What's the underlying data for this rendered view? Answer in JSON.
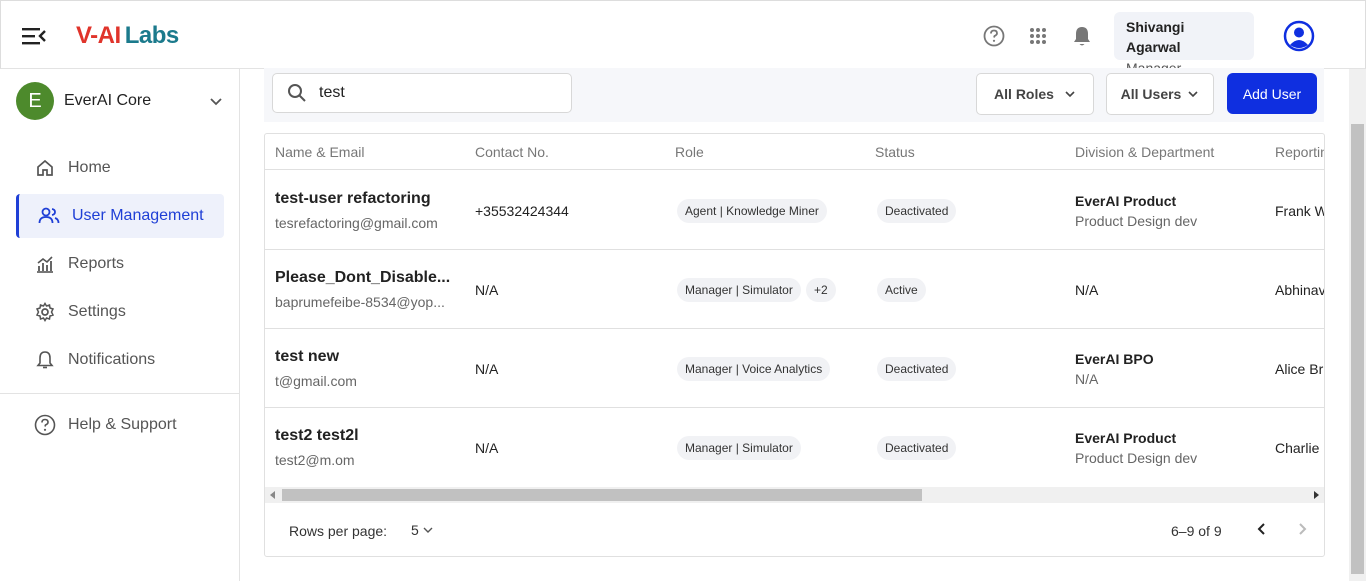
{
  "header": {
    "logo_text": "Labs",
    "logo_prefix": "V-AI",
    "user_name": "Shivangi Agarwal",
    "user_role": "Manager"
  },
  "sidebar": {
    "org_initial": "E",
    "org_name": "EverAI Core",
    "items": [
      {
        "label": "Home",
        "icon": "home-icon"
      },
      {
        "label": "User Management",
        "icon": "users-icon"
      },
      {
        "label": "Reports",
        "icon": "chart-icon"
      },
      {
        "label": "Settings",
        "icon": "gear-icon"
      },
      {
        "label": "Notifications",
        "icon": "bell-icon"
      },
      {
        "label": "Help & Support",
        "icon": "help-icon"
      }
    ],
    "active_item": "User Management"
  },
  "toolbar": {
    "search_value": "test",
    "roles_filter": "All Roles",
    "users_filter": "All Users",
    "add_user_label": "Add User"
  },
  "table": {
    "columns": [
      "Name & Email",
      "Contact No.",
      "Role",
      "Status",
      "Division & Department",
      "Reportin"
    ],
    "rows": [
      {
        "name": "test-user refactoring",
        "email": "tesrefactoring@gmail.com",
        "contact": "+35532424344",
        "role": "Agent | Knowledge Miner",
        "role_extra": "",
        "status": "Deactivated",
        "division": "EverAI Product",
        "department": "Product Design dev",
        "reporting": "Frank W"
      },
      {
        "name": "Please_Dont_Disable...",
        "email": "baprumefeibe-8534@yop...",
        "contact": "N/A",
        "role": "Manager | Simulator",
        "role_extra": "+2",
        "status": "Active",
        "division": "",
        "department": "N/A",
        "reporting": "Abhinav"
      },
      {
        "name": "test new",
        "email": "t@gmail.com",
        "contact": "N/A",
        "role": "Manager | Voice Analytics",
        "role_extra": "",
        "status": "Deactivated",
        "division": "EverAI BPO",
        "department": "N/A",
        "reporting": "Alice Br"
      },
      {
        "name": "test2 test2l",
        "email": "test2@m.om",
        "contact": "N/A",
        "role": "Manager | Simulator",
        "role_extra": "",
        "status": "Deactivated",
        "division": "EverAI Product",
        "department": "Product Design dev",
        "reporting": "Charlie"
      }
    ]
  },
  "pagination": {
    "rows_per_page_label": "Rows per page:",
    "rows_per_page": "5",
    "range": "6–9 of 9"
  },
  "colors": {
    "accent": "#0f2fe0",
    "org_badge": "#4d8a2c"
  }
}
